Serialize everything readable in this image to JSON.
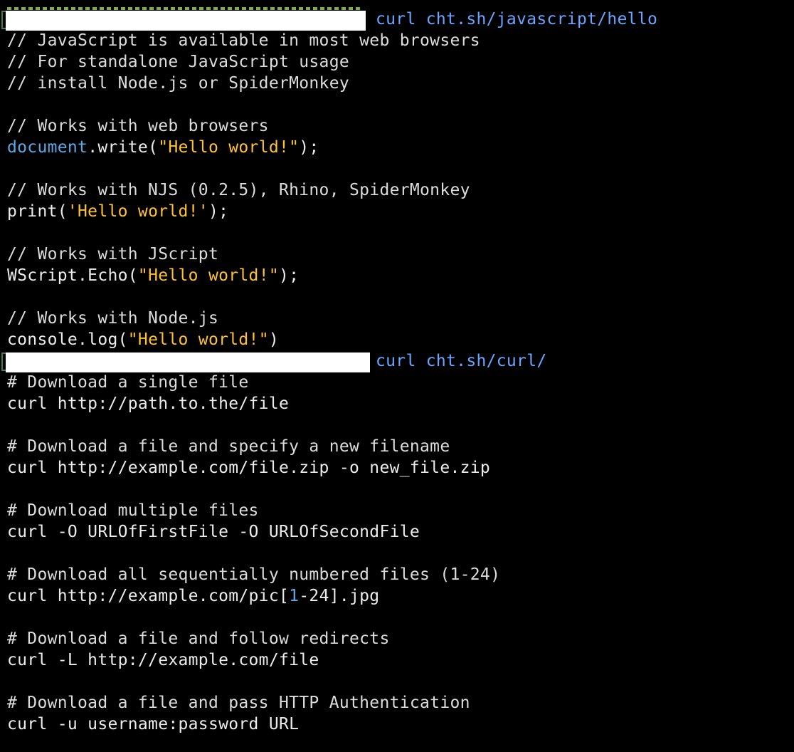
{
  "prompts": [
    {
      "command": "curl cht.sh/javascript/hello"
    },
    {
      "command": "curl cht.sh/curl/"
    }
  ],
  "js_output": {
    "c1": "// JavaScript is available in most web browsers",
    "c2": "// For standalone JavaScript usage",
    "c3": "// install Node.js or SpiderMonkey",
    "c4": "// Works with web browsers",
    "l5_obj": "document",
    "l5_call": ".write(",
    "l5_str": "\"Hello world!\"",
    "l5_end": ");",
    "c6": "// Works with NJS (0.2.5), Rhino, SpiderMonkey",
    "l7_call": "print(",
    "l7_str": "'Hello world!'",
    "l7_end": ");",
    "c8": "// Works with JScript",
    "l9_call": "WScript.Echo(",
    "l9_str": "\"Hello world!\"",
    "l9_end": ");",
    "c10": "// Works with Node.js",
    "l11_call": "console.log(",
    "l11_str": "\"Hello world!\"",
    "l11_end": ")"
  },
  "curl_output": {
    "c1": "# Download a single file",
    "l1": "curl http://path.to.the/file",
    "c2": "# Download a file and specify a new filename",
    "l2": "curl http://example.com/file.zip -o new_file.zip",
    "c3": "# Download multiple files",
    "l3": "curl -O URLOfFirstFile -O URLOfSecondFile",
    "c4": "# Download all sequentially numbered files (1-24)",
    "l4_a": "curl http://example.com/pic[",
    "l4_num": "1",
    "l4_b": "-24].jpg",
    "c5": "# Download a file and follow redirects",
    "l5": "curl -L http://example.com/file",
    "c6": "# Download a file and pass HTTP Authentication",
    "l6": "curl -u username:password URL"
  },
  "colors": {
    "background": "#000000",
    "command": "#6aa6ff",
    "string": "#ffc233",
    "keyword": "#5aa9e6",
    "text": "#ececec"
  }
}
